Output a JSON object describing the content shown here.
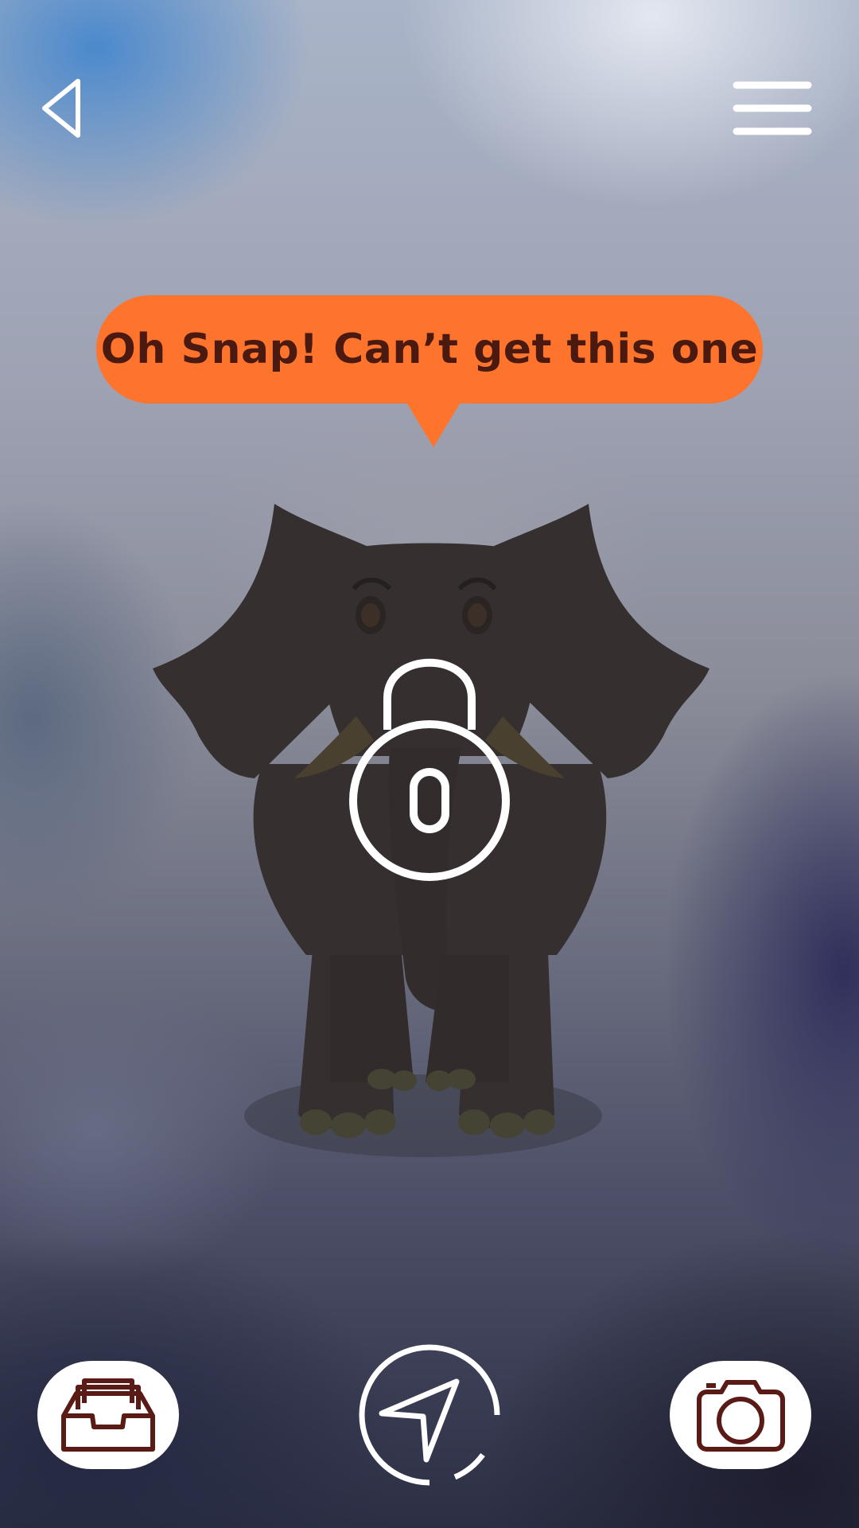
{
  "header": {
    "back_icon": "back-triangle-icon",
    "menu_icon": "hamburger-menu-icon"
  },
  "message": {
    "text": "Oh Snap! Can’t get this one",
    "color": "#ff742d",
    "text_color": "#4a1a10"
  },
  "content": {
    "animal": "elephant-silhouette",
    "lock_icon": "padlock-icon",
    "lock_count": "0"
  },
  "bottom_bar": {
    "inbox_icon": "inbox-tray-icon",
    "navigate_icon": "navigation-arrow-icon",
    "camera_icon": "camera-icon",
    "icon_color": "#5a1a15"
  }
}
